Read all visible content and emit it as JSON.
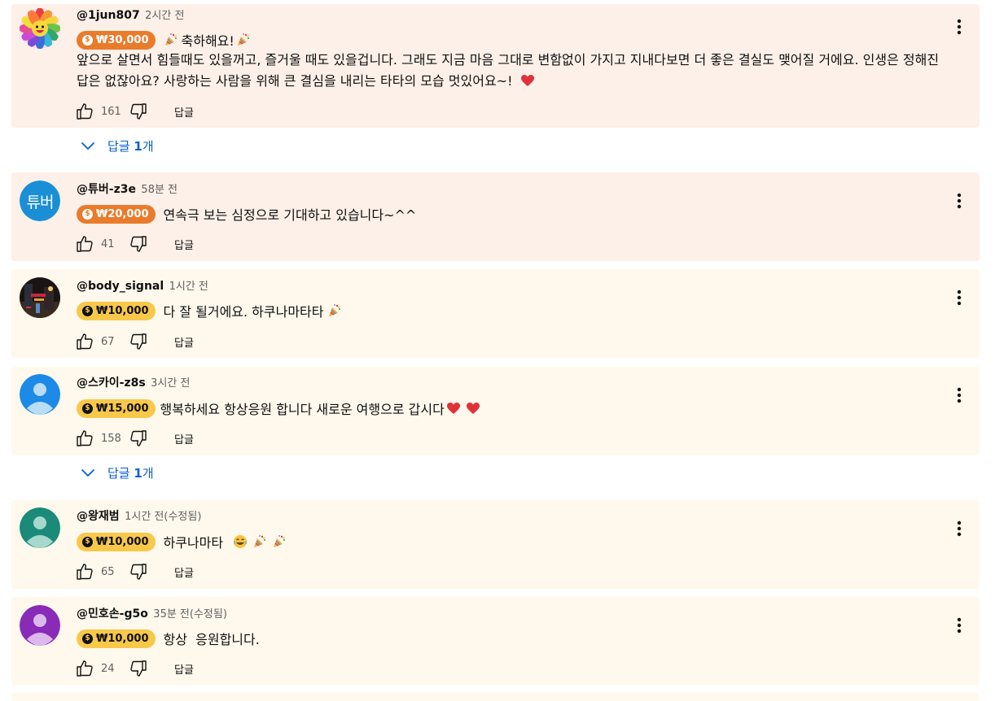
{
  "comments": [
    {
      "handle": "@1jun807",
      "time": "2시간 전",
      "amount": "₩30,000",
      "first_line": "축하해요!",
      "body": "앞으로 살면서 힘들때도 있을꺼고, 즐거울 때도 있을겁니다. 그래도 지금 마음 그대로 변함없이 가지고 지내다보면 더 좋은 결실도 맺어질 거에요. 인생은 정해진 답은 없잖아요? 사랑하는 사람을 위해 큰 결심을 내리는 타타의 모습 멋있어요~!",
      "likes": "161",
      "reply_label": "답글"
    },
    {
      "handle": "@튜버-z3e",
      "time": "58분 전",
      "avatar_text": "튜버",
      "amount": "₩20,000",
      "text": "연속극 보는 심정으로 기대하고 있습니다~^^",
      "likes": "41",
      "reply_label": "답글"
    },
    {
      "handle": "@body_signal",
      "time": "1시간 전",
      "amount": "₩10,000",
      "text": "다 잘 될거에요. 하쿠나마타타",
      "likes": "67",
      "reply_label": "답글"
    },
    {
      "handle": "@스카이-z8s",
      "time": "3시간 전",
      "amount": "₩15,000",
      "text": "행복하세요 항상응원 합니다 새로운 여행으로 갑시다",
      "likes": "158",
      "reply_label": "답글"
    },
    {
      "handle": "@왕재범",
      "time": "1시간 전(수정됨)",
      "amount": "₩10,000",
      "text": "하쿠나마타",
      "likes": "65",
      "reply_label": "답글"
    },
    {
      "handle": "@민호손-g5o",
      "time": "35분 전(수정됨)",
      "amount": "₩10,000",
      "text": "항상  응원합니다.",
      "likes": "24",
      "reply_label": "답글"
    }
  ],
  "replies_toggle": {
    "prefix": "답글 ",
    "count": "1",
    "suffix": "개"
  },
  "colors": {
    "orange_card": "#fdf0e8",
    "yellow_card": "#fef9ec",
    "orange_badge": "#e97b2b",
    "yellow_badge": "#f8c84a",
    "link_blue": "#065fd4",
    "heart_red": "#e0323a"
  },
  "icons": {
    "like": "thumbs-up-icon",
    "dislike": "thumbs-down-icon",
    "more": "kebab-menu-icon",
    "expand": "chevron-down-icon",
    "party": "party-popper-emoji",
    "heart": "red-heart-emoji",
    "laugh": "laughing-emoji"
  }
}
